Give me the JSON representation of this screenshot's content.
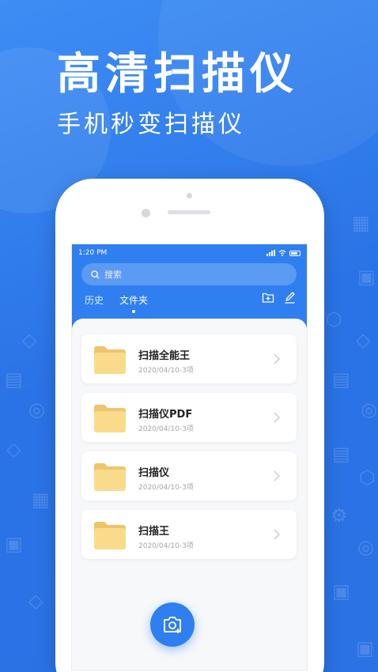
{
  "hero": {
    "title": "高清扫描仪",
    "subtitle": "手机秒变扫描仪"
  },
  "status_bar": {
    "time": "1:20 PM"
  },
  "search": {
    "placeholder": "搜索"
  },
  "tabs": [
    {
      "label": "历史",
      "active": false
    },
    {
      "label": "文件夹",
      "active": true
    }
  ],
  "folders": [
    {
      "name": "扫描全能王",
      "meta": "2020/04/10-3项"
    },
    {
      "name": "扫描仪PDF",
      "meta": "2020/04/10-3项"
    },
    {
      "name": "扫描仪",
      "meta": "2020/04/10-3项"
    },
    {
      "name": "扫描王",
      "meta": "2020/04/10-3项"
    }
  ],
  "icons": {
    "search": "search-icon",
    "new_folder": "new-folder-icon",
    "edit": "edit-icon",
    "folder": "folder-icon",
    "chevron": "chevron-right-icon",
    "camera": "camera-icon"
  },
  "colors": {
    "primary": "#2f7ff0",
    "background": "#2f7bea",
    "folder": "#f9db8b"
  }
}
